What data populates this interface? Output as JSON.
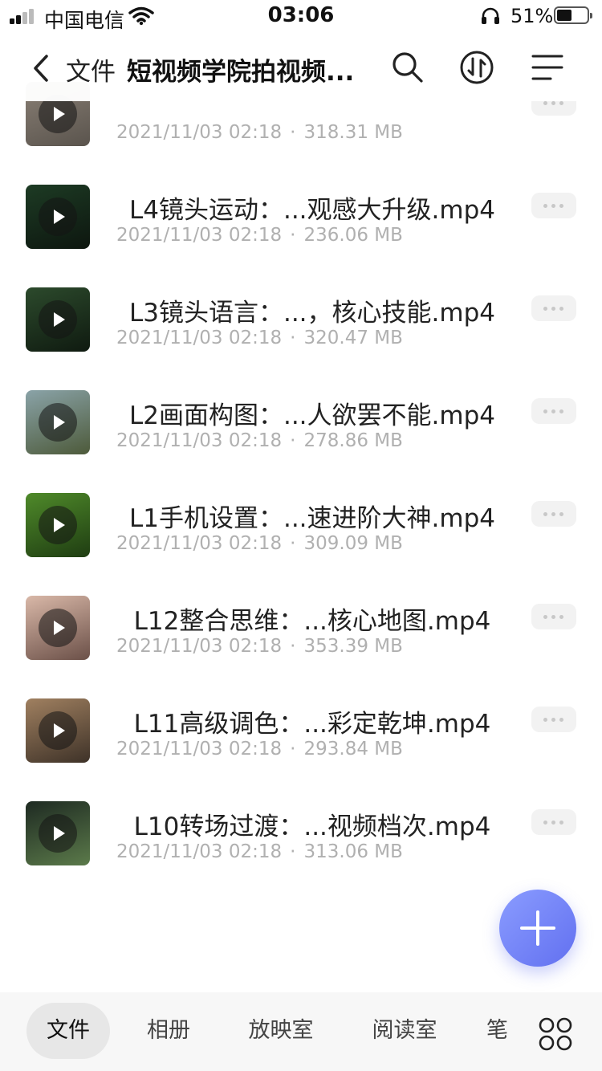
{
  "status_bar": {
    "carrier": "中国电信",
    "time": "03:06",
    "battery_percent": "51%",
    "battery_level": 0.51
  },
  "header": {
    "back_label": "文件",
    "folder_title": "短视频学院拍视频..."
  },
  "files": [
    {
      "name": "",
      "date": "2021/11/03 02:18",
      "size": "318.31 MB",
      "thumb_colors": [
        "#8a8076",
        "#5a544d"
      ]
    },
    {
      "name": "L4镜头运动：...观感大升级.mp4",
      "date": "2021/11/03 02:18",
      "size": "236.06 MB",
      "thumb_colors": [
        "#1d3b24",
        "#0d160f"
      ]
    },
    {
      "name": "L3镜头语言：...，核心技能.mp4",
      "date": "2021/11/03 02:18",
      "size": "320.47 MB",
      "thumb_colors": [
        "#2c4a2c",
        "#0f1a10"
      ]
    },
    {
      "name": "L2画面构图：...人欲罢不能.mp4",
      "date": "2021/11/03 02:18",
      "size": "278.86 MB",
      "thumb_colors": [
        "#8aa3a8",
        "#4d5a3a"
      ]
    },
    {
      "name": "L1手机设置：...速进阶大神.mp4",
      "date": "2021/11/03 02:18",
      "size": "309.09 MB",
      "thumb_colors": [
        "#4f8a2a",
        "#1f3d12"
      ]
    },
    {
      "name": "L12整合思维：...核心地图.mp4",
      "date": "2021/11/03 02:18",
      "size": "353.39 MB",
      "thumb_colors": [
        "#d9b8a8",
        "#6b5048"
      ]
    },
    {
      "name": "L11高级调色：...彩定乾坤.mp4",
      "date": "2021/11/03 02:18",
      "size": "293.84 MB",
      "thumb_colors": [
        "#a08060",
        "#3e3228"
      ]
    },
    {
      "name": "L10转场过渡：...视频档次.mp4",
      "date": "2021/11/03 02:18",
      "size": "313.06 MB",
      "thumb_colors": [
        "#1e2a22",
        "#5b7a4a"
      ]
    }
  ],
  "meta_separator": "·",
  "tabs": [
    {
      "label": "文件",
      "active": true
    },
    {
      "label": "相册",
      "active": false
    },
    {
      "label": "放映室",
      "active": false
    },
    {
      "label": "阅读室",
      "active": false
    },
    {
      "label": "笔",
      "active": false
    }
  ],
  "icons": {
    "back": "chevron-left-icon",
    "search": "search-icon",
    "sort": "sort-icon",
    "menu": "menu-icon",
    "play": "play-icon",
    "more": "more-dots-icon",
    "add": "plus-icon",
    "apps": "grid-icon"
  },
  "colors": {
    "accent": "#6d7cf5",
    "meta_text": "#b0b0b0",
    "tab_active_bg": "#e7e7e7"
  }
}
